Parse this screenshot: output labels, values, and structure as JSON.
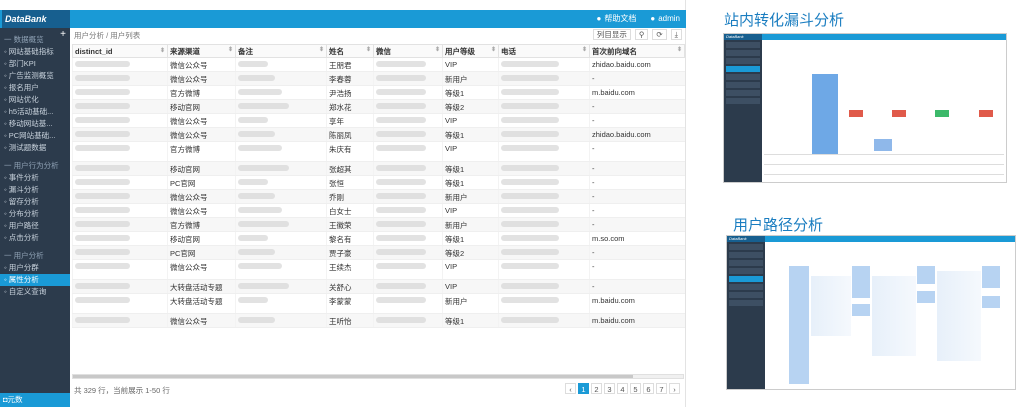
{
  "app": {
    "logo": "DataBank",
    "help_label": "帮助文档",
    "user_label": "admin"
  },
  "sidebar": {
    "groups": [
      {
        "label": "一 数据概览",
        "items": [
          "网站基础指标",
          "部门KPI",
          "广告监测概览",
          "报名用户",
          "网站优化",
          "h5活动基础...",
          "移动网站基...",
          "PC网站基础...",
          "测试题数据"
        ]
      },
      {
        "label": "一 用户行为分析",
        "items": [
          "事件分析",
          "漏斗分析",
          "留存分析",
          "分布分析",
          "用户路径",
          "点击分析"
        ]
      },
      {
        "label": "一 用户分析",
        "items": [
          "用户分群",
          "属性分析",
          "自定义查询"
        ]
      }
    ],
    "active_item": "属性分析",
    "bottom_label": "元数"
  },
  "main": {
    "breadcrumb": "用户分析 / 用户列表",
    "column_display": "列目显示",
    "columns": [
      "distinct_id",
      "来源渠道",
      "备注",
      "姓名",
      "微信",
      "用户等级",
      "电话",
      "首次前向域名"
    ],
    "rows": [
      {
        "channel": "微信公众号",
        "name": "王朋君",
        "level": "VIP",
        "domain": "zhidao.baidu.com"
      },
      {
        "channel": "微信公众号",
        "name": "李春蓉",
        "level": "新用户",
        "domain": "-"
      },
      {
        "channel": "官方微博",
        "name": "尹浩扬",
        "level": "等级1",
        "domain": "m.baidu.com"
      },
      {
        "channel": "移动官网",
        "name": "郑水花",
        "level": "等级2",
        "domain": "-"
      },
      {
        "channel": "微信公众号",
        "name": "享年",
        "level": "VIP",
        "domain": "-"
      },
      {
        "channel": "微信公众号",
        "name": "陈丽凤",
        "level": "等级1",
        "domain": "zhidao.baidu.com"
      },
      {
        "channel": "官方微博",
        "name": "朱庆有",
        "level": "VIP",
        "domain": "-"
      },
      {
        "channel": "移动官网",
        "name": "张超其",
        "level": "等级1",
        "domain": "-"
      },
      {
        "channel": "PC官网",
        "name": "张恒",
        "level": "等级1",
        "domain": "-"
      },
      {
        "channel": "微信公众号",
        "name": "乔刚",
        "level": "新用户",
        "domain": "-"
      },
      {
        "channel": "微信公众号",
        "name": "白女士",
        "level": "VIP",
        "domain": "-"
      },
      {
        "channel": "官方微博",
        "name": "王徽荣",
        "level": "新用户",
        "domain": "-"
      },
      {
        "channel": "移动官网",
        "name": "黎名有",
        "level": "等级1",
        "domain": "m.so.com"
      },
      {
        "channel": "PC官网",
        "name": "贾子豪",
        "level": "等级2",
        "domain": "-"
      },
      {
        "channel": "微信公众号",
        "name": "王续杰",
        "level": "VIP",
        "domain": "-"
      },
      {
        "channel": "大转盘活动专题",
        "name": "关舒心",
        "level": "VIP",
        "domain": "-"
      },
      {
        "channel": "大转盘活动专题",
        "name": "李蒙蒙",
        "level": "新用户",
        "domain": "m.baidu.com"
      },
      {
        "channel": "微信公众号",
        "name": "王听怡",
        "level": "等级1",
        "domain": "m.baidu.com"
      }
    ],
    "footer_info": "共 329 行，当前展示 1-50 行",
    "pages": [
      "1",
      "2",
      "3",
      "4",
      "5",
      "6",
      "7"
    ],
    "current_page": "1"
  },
  "promos": {
    "funnel_title": "站内转化漏斗分析",
    "path_title": "用户路径分析"
  },
  "colors": {
    "accent": "#1a9ad6",
    "sidebar_bg": "#2c3b4c",
    "logo_bg": "#175f8f"
  }
}
